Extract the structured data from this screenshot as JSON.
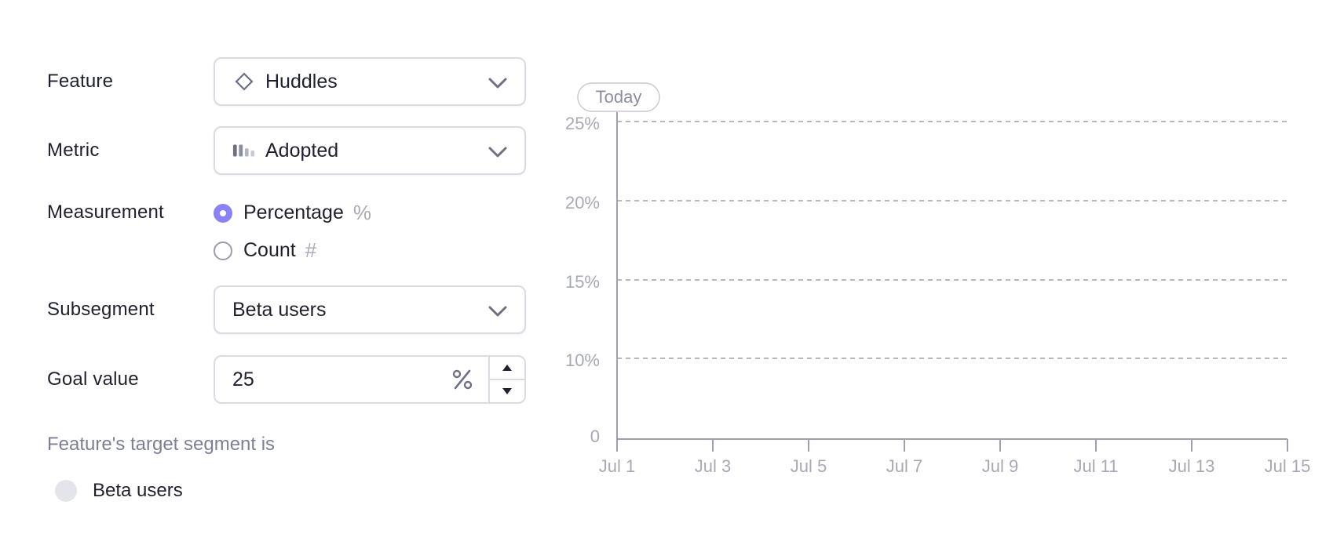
{
  "form": {
    "feature": {
      "label": "Feature",
      "value": "Huddles",
      "icon": "diamond-icon"
    },
    "metric": {
      "label": "Metric",
      "value": "Adopted",
      "icon": "bars-icon"
    },
    "measurement": {
      "label": "Measurement",
      "options": [
        {
          "label": "Percentage",
          "glyph": "%",
          "selected": true
        },
        {
          "label": "Count",
          "glyph": "#",
          "selected": false
        }
      ]
    },
    "subsegment": {
      "label": "Subsegment",
      "value": "Beta users"
    },
    "goal": {
      "label": "Goal value",
      "value": "25",
      "unit": "%"
    },
    "target_hint": "Feature's target segment is",
    "target_segment": "Beta users"
  },
  "colors": {
    "accent": "#8b82f6",
    "border": "#dadbe3",
    "muted_text": "#a7a9b8",
    "grid": "#9ea0ae"
  },
  "chart_data": {
    "type": "line",
    "marker_label": "Today",
    "marker_x": "Jul 1",
    "x_ticks": [
      "Jul 1",
      "Jul 3",
      "Jul 5",
      "Jul 7",
      "Jul 9",
      "Jul 11",
      "Jul 13",
      "Jul 15"
    ],
    "y_ticks": [
      "0",
      "10%",
      "15%",
      "20%",
      "25%"
    ],
    "ylim": [
      0,
      25
    ],
    "grid": true,
    "series": []
  }
}
